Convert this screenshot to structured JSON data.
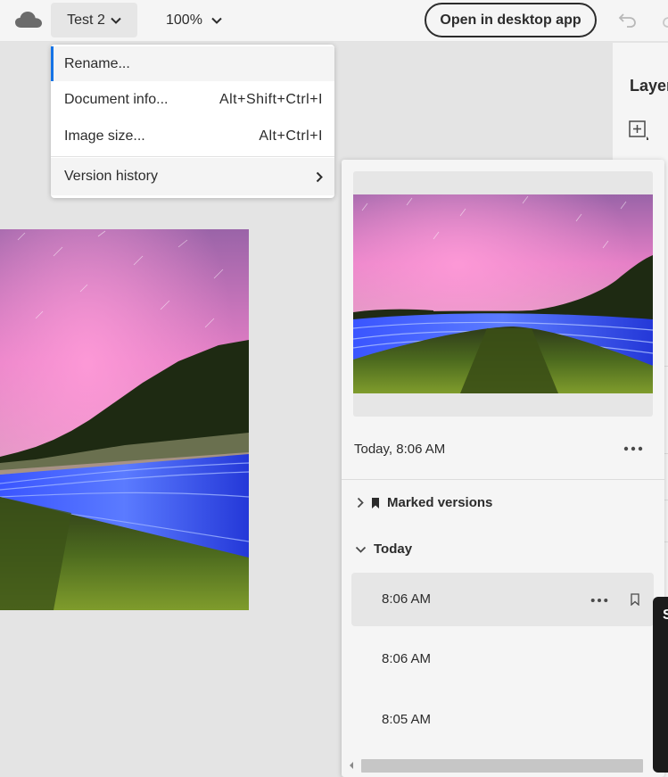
{
  "topbar": {
    "document_name": "Test 2",
    "zoom": "100%",
    "open_desktop_label": "Open in desktop app"
  },
  "menu": {
    "items": [
      {
        "label": "Rename...",
        "shortcut": ""
      },
      {
        "label": "Document info...",
        "shortcut": "Alt+Shift+Ctrl+I"
      },
      {
        "label": "Image size...",
        "shortcut": "Alt+Ctrl+I"
      },
      {
        "label": "Version history",
        "shortcut": ""
      }
    ]
  },
  "right_panel": {
    "title": "Layer"
  },
  "version_history": {
    "current_timestamp": "Today, 8:06 AM",
    "marked_versions_label": "Marked versions",
    "today_label": "Today",
    "versions": [
      "8:06 AM",
      "8:06 AM",
      "8:05 AM"
    ]
  },
  "tooltip": {
    "initial": "S"
  },
  "colors": {
    "accent": "#1473e6",
    "panel_bg": "#f5f5f5",
    "canvas_bg": "#e4e4e4"
  },
  "icons": [
    "cloud-icon",
    "chevron-down-icon",
    "undo-icon",
    "add-layer-icon",
    "chevron-right-icon",
    "bookmark-icon",
    "more-icon"
  ]
}
